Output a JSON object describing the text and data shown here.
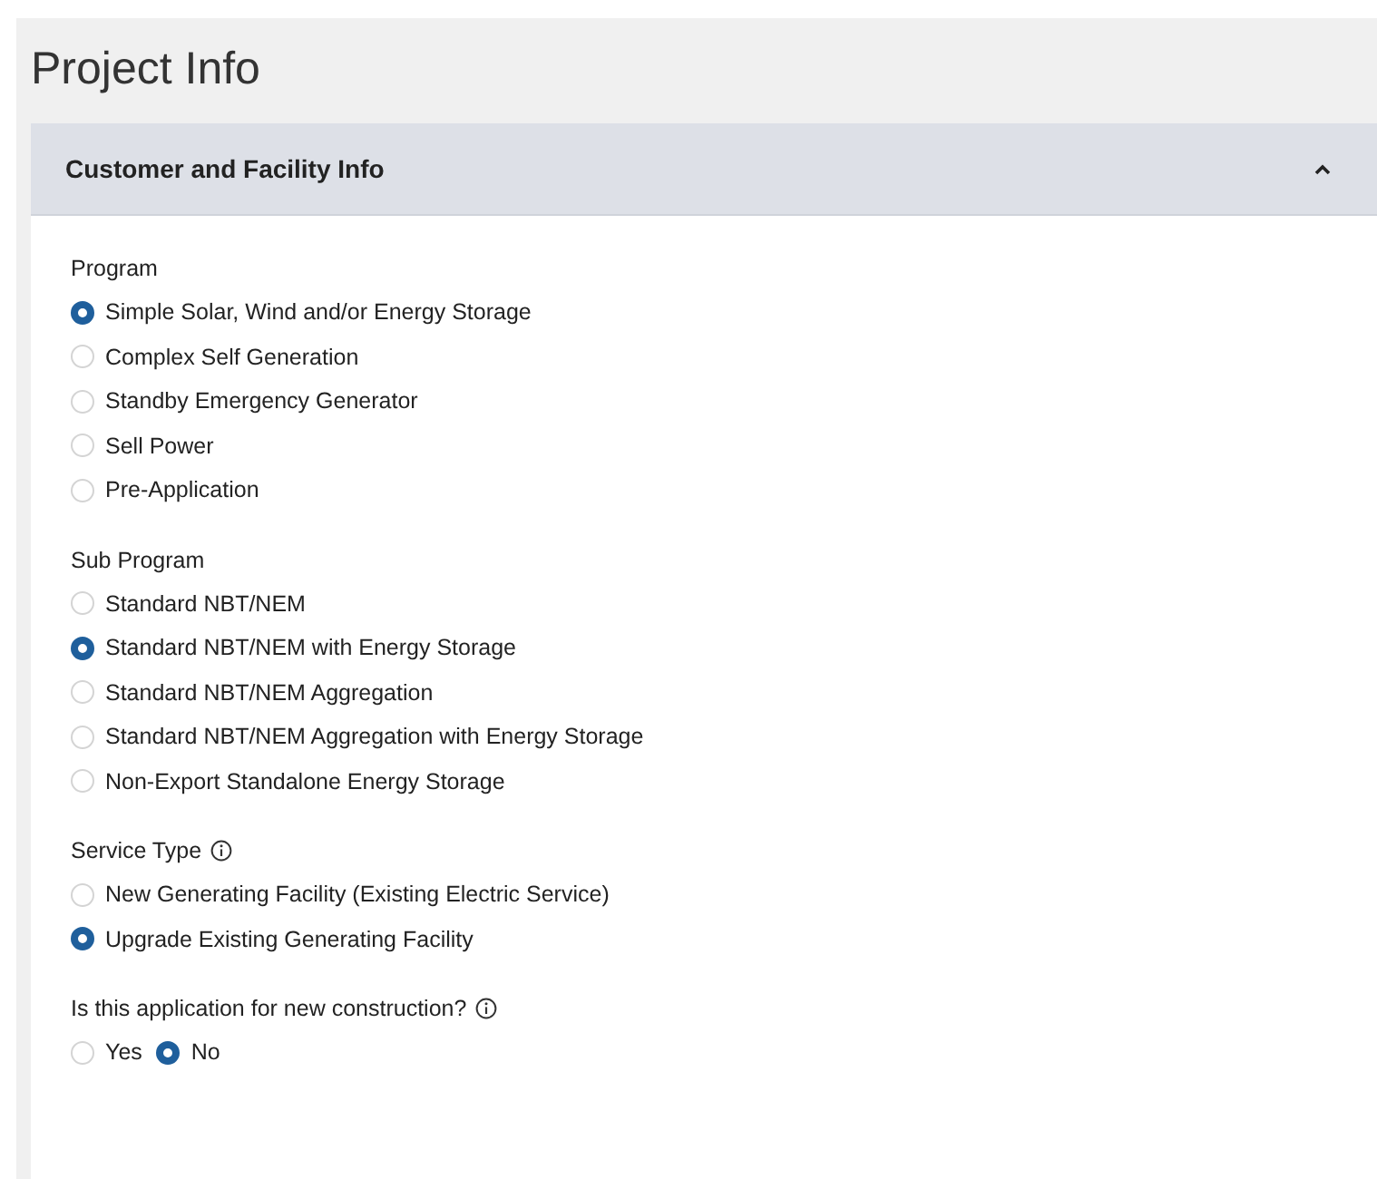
{
  "page_title": "Project Info",
  "panel": {
    "title": "Customer and Facility Info",
    "expanded": true,
    "groups": [
      {
        "label": "Program",
        "info": false,
        "inline": false,
        "options": [
          {
            "label": "Simple Solar, Wind and/or Energy Storage",
            "selected": true
          },
          {
            "label": "Complex Self Generation",
            "selected": false
          },
          {
            "label": "Standby Emergency Generator",
            "selected": false
          },
          {
            "label": "Sell Power",
            "selected": false
          },
          {
            "label": "Pre-Application",
            "selected": false
          }
        ]
      },
      {
        "label": "Sub Program",
        "info": false,
        "inline": false,
        "options": [
          {
            "label": "Standard NBT/NEM",
            "selected": false
          },
          {
            "label": "Standard NBT/NEM with Energy Storage",
            "selected": true
          },
          {
            "label": "Standard NBT/NEM Aggregation",
            "selected": false
          },
          {
            "label": "Standard NBT/NEM Aggregation with Energy Storage",
            "selected": false
          },
          {
            "label": "Non-Export Standalone Energy Storage",
            "selected": false
          }
        ]
      },
      {
        "label": "Service Type",
        "info": true,
        "inline": false,
        "options": [
          {
            "label": "New Generating Facility (Existing Electric Service)",
            "selected": false
          },
          {
            "label": "Upgrade Existing Generating Facility",
            "selected": true
          }
        ]
      },
      {
        "label": "Is this application for new construction?",
        "info": true,
        "inline": true,
        "options": [
          {
            "label": "Yes",
            "selected": false
          },
          {
            "label": "No",
            "selected": true
          }
        ]
      }
    ]
  }
}
